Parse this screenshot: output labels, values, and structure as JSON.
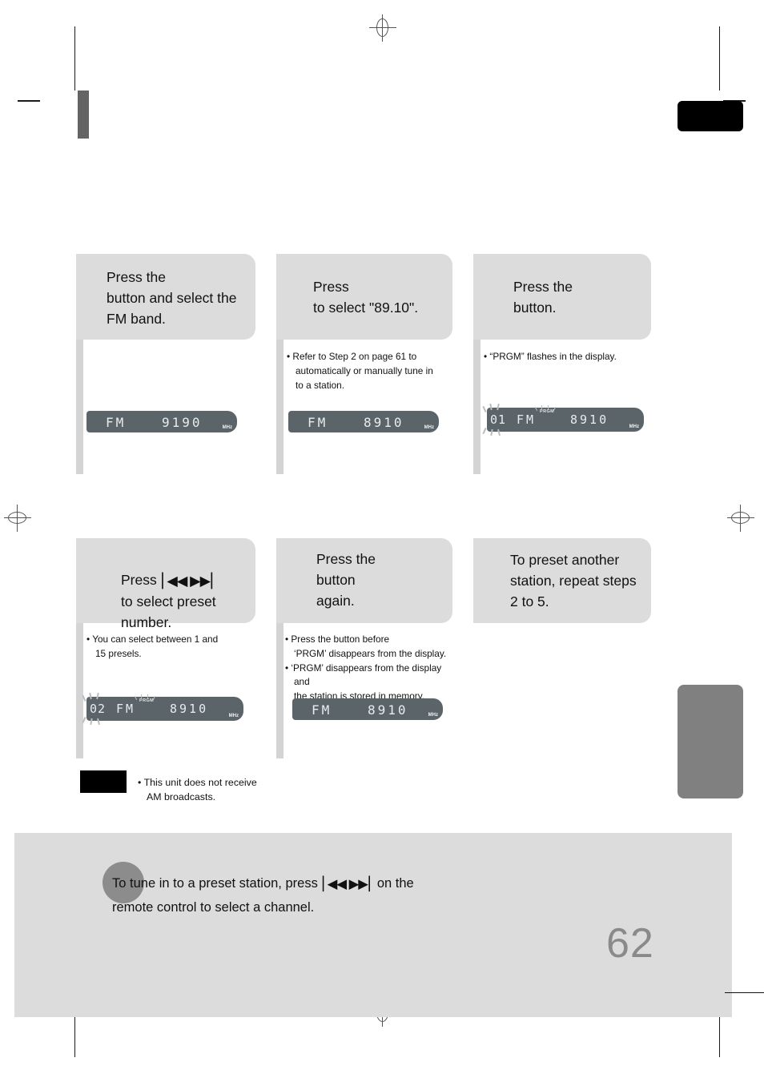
{
  "page": {
    "number": "62",
    "chapter_tab_label": "",
    "side_tab_label": ""
  },
  "steps": [
    {
      "id": "step-3",
      "callout": "Press the\nbutton and select the\nFM band.",
      "bullets": [],
      "display": {
        "band": "FM",
        "frequency": "9190",
        "unit": "MHz",
        "preset": "",
        "prgm": "",
        "flashing": false
      }
    },
    {
      "id": "step-4",
      "callout": "Press\nto select \"89.10\".",
      "bullets": [
        "Refer to Step 2 on page 61 to",
        "automatically or manually tune in",
        "to a station."
      ],
      "display": {
        "band": "FM",
        "frequency": "8910",
        "unit": "MHz",
        "preset": "",
        "prgm": "",
        "flashing": false
      }
    },
    {
      "id": "step-5",
      "callout": "Press the\nbutton.",
      "bullets": [
        "“PRGM” flashes in the display."
      ],
      "display": {
        "band": "FM",
        "frequency": "8910",
        "unit": "MHz",
        "preset": "01",
        "prgm": "PRGM",
        "flashing": true
      }
    },
    {
      "id": "step-6",
      "callout_prefix": "Press ",
      "callout_glyph": "prev-next-buttons",
      "callout": "\nto select preset\nnumber.",
      "bullets": [
        "You can select between 1 and",
        "15 presels."
      ],
      "display": {
        "band": "FM",
        "frequency": "8910",
        "unit": "MHz",
        "preset": "02",
        "prgm": "PRGM",
        "flashing": true
      }
    },
    {
      "id": "step-7",
      "callout": "Press the\nbutton\nagain.",
      "bullets": [
        "Press the                         button before",
        "‘PRGM’ disappears from the display.",
        "‘PRGM’ disappears from the display and",
        "the station is stored in memory."
      ],
      "display": {
        "band": "FM",
        "frequency": "8910",
        "unit": "MHz",
        "preset": "",
        "prgm": "",
        "flashing": false
      }
    },
    {
      "id": "step-8",
      "callout": "To preset another\nstation, repeat steps\n2 to 5.",
      "bullets": [],
      "display": null
    }
  ],
  "note": {
    "badge_label": "",
    "lines": [
      "This unit does not receive",
      "AM broadcasts."
    ]
  },
  "tip": {
    "line1_before": "To tune in to a preset station, press ",
    "glyph": "prev-next-buttons",
    "line1_after": " on the",
    "line2": "remote control to select a channel."
  },
  "glyphs": {
    "prev": "◀◀",
    "next": "▶▶",
    "bar": "|"
  },
  "colors": {
    "callout_bg": "#dcdcdc",
    "lcd_bg": "#5b6468",
    "lcd_text": "#e8ecee",
    "tab_black": "#000000",
    "tab_gray": "#808080",
    "page_number": "#8a8a8a"
  }
}
